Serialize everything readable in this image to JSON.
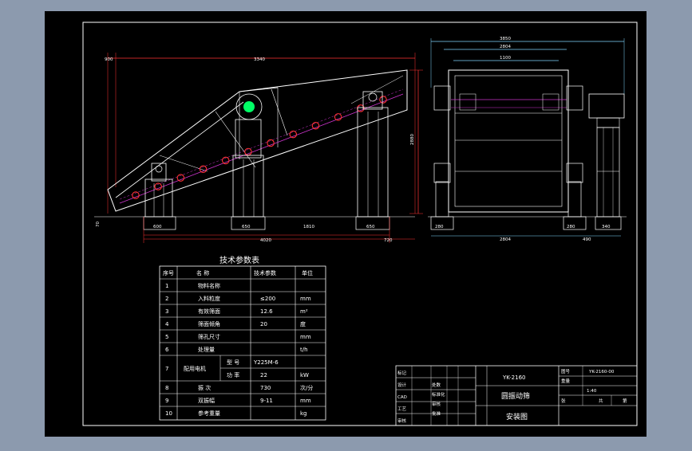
{
  "colors": {
    "background": "#8c9aae",
    "canvas": "#000000",
    "line": "#ffffff",
    "dimension": "#ff3333",
    "accent": "#00ff66",
    "cyan": "#00ffff",
    "outline": "#7fd6ff"
  },
  "side_view": {
    "top_dims": [
      "900",
      "3340"
    ],
    "right_dim": "2880",
    "left_small_dims": [
      "70"
    ],
    "bottom_dims": [
      "600",
      "650",
      "1810",
      "650"
    ],
    "bottom_total": [
      "4020",
      "720"
    ]
  },
  "end_view": {
    "top_dims": [
      "3850",
      "2804",
      "1100"
    ],
    "bottom_dims": [
      "280",
      "2804",
      "280",
      "490",
      "340"
    ]
  },
  "params_table": {
    "title": "技术参数表",
    "headers": [
      "序号",
      "名  称",
      "技术参数",
      "单位"
    ],
    "rows": [
      {
        "no": "1",
        "name": "物料名称",
        "value": "",
        "unit": ""
      },
      {
        "no": "2",
        "name": "入料粒度",
        "value": "≤200",
        "unit": "mm"
      },
      {
        "no": "3",
        "name": "有效筛面",
        "value": "12.6",
        "unit": "m²"
      },
      {
        "no": "4",
        "name": "筛面倾角",
        "value": "20",
        "unit": "度"
      },
      {
        "no": "5",
        "name": "筛孔尺寸",
        "value": "",
        "unit": "mm"
      },
      {
        "no": "6",
        "name": "处理量",
        "value": "",
        "unit": "t/h"
      },
      {
        "no": "8",
        "name": "振  次",
        "value": "730",
        "unit": "次/分"
      },
      {
        "no": "9",
        "name": "双振幅",
        "value": "9-11",
        "unit": "mm"
      },
      {
        "no": "10",
        "name": "参考重量",
        "value": "",
        "unit": "kg"
      }
    ],
    "motor_row": {
      "no": "7",
      "name": "配用电机",
      "sub": [
        {
          "label": "型  号",
          "value": "Y225M-6",
          "unit": ""
        },
        {
          "label": "功  率",
          "value": "22",
          "unit": "kW"
        }
      ]
    }
  },
  "title_block": {
    "model": "YK-2160",
    "name": "圆振动筛",
    "drawing": "安装图",
    "code": "YK-2160-00",
    "scale": "1:40",
    "left_labels": [
      "标记",
      "设计",
      "CAD",
      "工艺",
      "审核"
    ],
    "left_labels2": [
      "处数",
      "标准化",
      "审核",
      "批准"
    ],
    "right_labels": [
      "图号",
      "重量",
      "比例",
      "张",
      "共",
      "第"
    ]
  }
}
